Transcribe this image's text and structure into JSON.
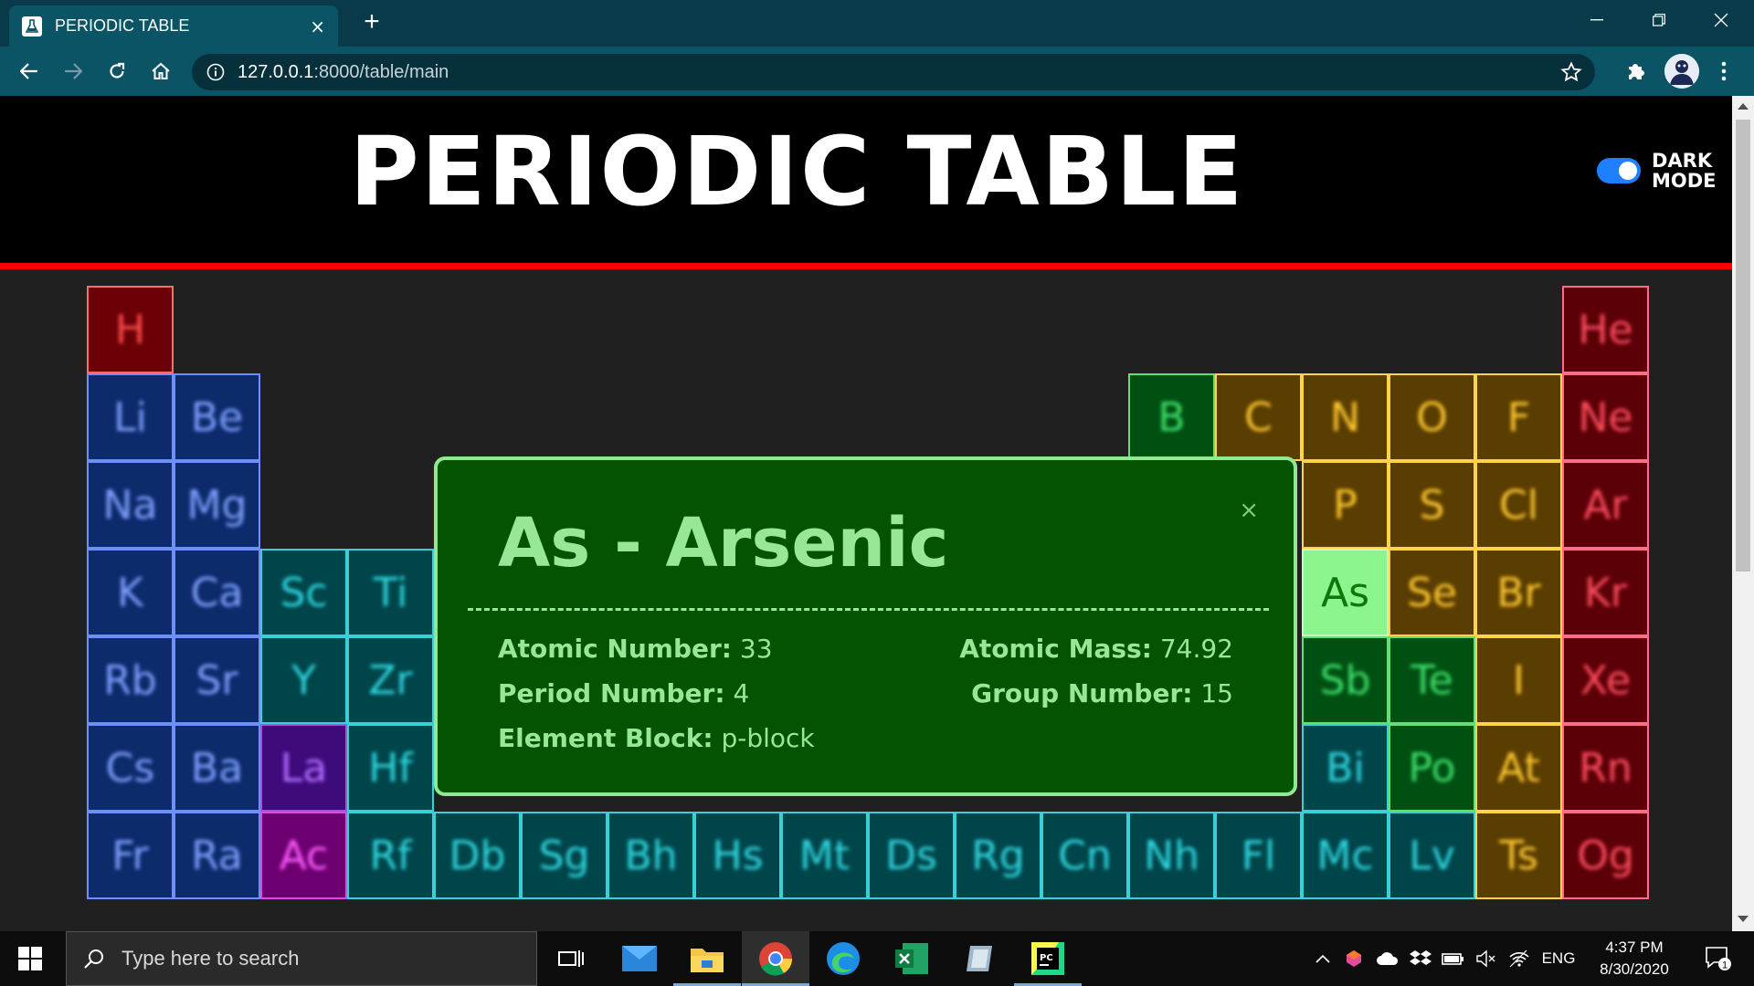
{
  "browser": {
    "tab_title": "PERIODIC TABLE",
    "tab_close": "×",
    "new_tab": "+",
    "url_host": "127.0.0.1",
    "url_path": ":8000/table/main"
  },
  "header": {
    "title": "PERIODIC TABLE",
    "dark_mode_line1": "DARK",
    "dark_mode_line2": "MODE",
    "dark_mode_on": true
  },
  "colors": {
    "nonmetal_red": "#6b0006",
    "alkali": "#0d2a6b",
    "transition": "#00454a",
    "lanthanide": "#3d0b7a",
    "actinide": "#6d0070",
    "metalloid_green": "#005012",
    "halogen_gold": "#5a3d00",
    "noble": "#5c0008",
    "selected": "#8df58d"
  },
  "elements": [
    {
      "symbol": "H",
      "cat": "nonmetal_red",
      "col": 1,
      "row": 1
    },
    {
      "symbol": "He",
      "cat": "noble",
      "col": 18,
      "row": 1
    },
    {
      "symbol": "Li",
      "cat": "alkali",
      "col": 1,
      "row": 2
    },
    {
      "symbol": "Be",
      "cat": "alkali",
      "col": 2,
      "row": 2
    },
    {
      "symbol": "B",
      "cat": "metalloid_green",
      "col": 13,
      "row": 2
    },
    {
      "symbol": "C",
      "cat": "halogen_gold",
      "col": 14,
      "row": 2
    },
    {
      "symbol": "N",
      "cat": "halogen_gold",
      "col": 15,
      "row": 2
    },
    {
      "symbol": "O",
      "cat": "halogen_gold",
      "col": 16,
      "row": 2
    },
    {
      "symbol": "F",
      "cat": "halogen_gold",
      "col": 17,
      "row": 2
    },
    {
      "symbol": "Ne",
      "cat": "noble",
      "col": 18,
      "row": 2
    },
    {
      "symbol": "Na",
      "cat": "alkali",
      "col": 1,
      "row": 3
    },
    {
      "symbol": "Mg",
      "cat": "alkali",
      "col": 2,
      "row": 3
    },
    {
      "symbol": "P",
      "cat": "halogen_gold",
      "col": 15,
      "row": 3
    },
    {
      "symbol": "S",
      "cat": "halogen_gold",
      "col": 16,
      "row": 3
    },
    {
      "symbol": "Cl",
      "cat": "halogen_gold",
      "col": 17,
      "row": 3
    },
    {
      "symbol": "Ar",
      "cat": "noble",
      "col": 18,
      "row": 3
    },
    {
      "symbol": "K",
      "cat": "alkali",
      "col": 1,
      "row": 4
    },
    {
      "symbol": "Ca",
      "cat": "alkali",
      "col": 2,
      "row": 4
    },
    {
      "symbol": "Sc",
      "cat": "transition",
      "col": 3,
      "row": 4
    },
    {
      "symbol": "Ti",
      "cat": "transition",
      "col": 4,
      "row": 4
    },
    {
      "symbol": "As",
      "cat": "selected",
      "col": 15,
      "row": 4
    },
    {
      "symbol": "Se",
      "cat": "halogen_gold",
      "col": 16,
      "row": 4
    },
    {
      "symbol": "Br",
      "cat": "halogen_gold",
      "col": 17,
      "row": 4
    },
    {
      "symbol": "Kr",
      "cat": "noble",
      "col": 18,
      "row": 4
    },
    {
      "symbol": "Rb",
      "cat": "alkali",
      "col": 1,
      "row": 5
    },
    {
      "symbol": "Sr",
      "cat": "alkali",
      "col": 2,
      "row": 5
    },
    {
      "symbol": "Y",
      "cat": "transition",
      "col": 3,
      "row": 5
    },
    {
      "symbol": "Zr",
      "cat": "transition",
      "col": 4,
      "row": 5
    },
    {
      "symbol": "Sb",
      "cat": "metalloid_green",
      "col": 15,
      "row": 5
    },
    {
      "symbol": "Te",
      "cat": "metalloid_green",
      "col": 16,
      "row": 5
    },
    {
      "symbol": "I",
      "cat": "halogen_gold",
      "col": 17,
      "row": 5
    },
    {
      "symbol": "Xe",
      "cat": "noble",
      "col": 18,
      "row": 5
    },
    {
      "symbol": "Cs",
      "cat": "alkali",
      "col": 1,
      "row": 6
    },
    {
      "symbol": "Ba",
      "cat": "alkali",
      "col": 2,
      "row": 6
    },
    {
      "symbol": "La",
      "cat": "lanthanide",
      "col": 3,
      "row": 6
    },
    {
      "symbol": "Hf",
      "cat": "transition",
      "col": 4,
      "row": 6
    },
    {
      "symbol": "Bi",
      "cat": "transition",
      "col": 15,
      "row": 6
    },
    {
      "symbol": "Po",
      "cat": "metalloid_green",
      "col": 16,
      "row": 6
    },
    {
      "symbol": "At",
      "cat": "halogen_gold",
      "col": 17,
      "row": 6
    },
    {
      "symbol": "Rn",
      "cat": "noble",
      "col": 18,
      "row": 6
    },
    {
      "symbol": "Fr",
      "cat": "alkali",
      "col": 1,
      "row": 7
    },
    {
      "symbol": "Ra",
      "cat": "alkali",
      "col": 2,
      "row": 7
    },
    {
      "symbol": "Ac",
      "cat": "actinide",
      "col": 3,
      "row": 7
    },
    {
      "symbol": "Rf",
      "cat": "transition",
      "col": 4,
      "row": 7
    },
    {
      "symbol": "Db",
      "cat": "transition",
      "col": 5,
      "row": 7
    },
    {
      "symbol": "Sg",
      "cat": "transition",
      "col": 6,
      "row": 7
    },
    {
      "symbol": "Bh",
      "cat": "transition",
      "col": 7,
      "row": 7
    },
    {
      "symbol": "Hs",
      "cat": "transition",
      "col": 8,
      "row": 7
    },
    {
      "symbol": "Mt",
      "cat": "transition",
      "col": 9,
      "row": 7
    },
    {
      "symbol": "Ds",
      "cat": "transition",
      "col": 10,
      "row": 7
    },
    {
      "symbol": "Rg",
      "cat": "transition",
      "col": 11,
      "row": 7
    },
    {
      "symbol": "Cn",
      "cat": "transition",
      "col": 12,
      "row": 7
    },
    {
      "symbol": "Nh",
      "cat": "transition",
      "col": 13,
      "row": 7
    },
    {
      "symbol": "Fl",
      "cat": "transition",
      "col": 14,
      "row": 7
    },
    {
      "symbol": "Mc",
      "cat": "transition",
      "col": 15,
      "row": 7
    },
    {
      "symbol": "Lv",
      "cat": "transition",
      "col": 16,
      "row": 7
    },
    {
      "symbol": "Ts",
      "cat": "halogen_gold",
      "col": 17,
      "row": 7
    },
    {
      "symbol": "Og",
      "cat": "noble",
      "col": 18,
      "row": 7
    }
  ],
  "modal": {
    "title": "As - Arsenic",
    "close": "×",
    "atomic_number_label": "Atomic Number:",
    "atomic_number": "33",
    "atomic_mass_label": "Atomic Mass:",
    "atomic_mass": "74.92",
    "period_label": "Period Number:",
    "period": "4",
    "group_label": "Group Number:",
    "group": "15",
    "block_label": "Element Block:",
    "block": "p-block"
  },
  "taskbar": {
    "search_placeholder": "Type here to search",
    "language": "ENG",
    "time": "4:37 PM",
    "date": "8/30/2020",
    "notification_count": "1"
  }
}
